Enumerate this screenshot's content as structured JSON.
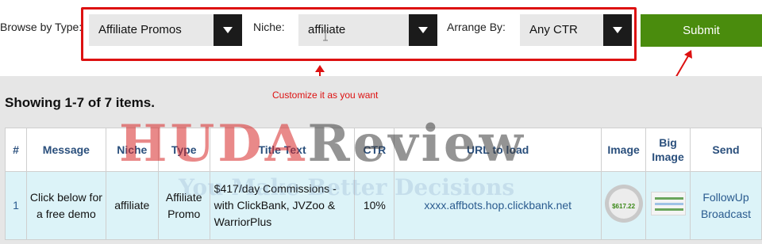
{
  "filters": {
    "browse_label": "Browse by Type:",
    "type_value": "Affiliate Promos",
    "niche_label": "Niche:",
    "niche_value": "affiliate",
    "arrange_label": "Arrange By:",
    "arrange_value": "Any CTR",
    "submit_label": "Submit"
  },
  "annotation": "Customize it as you want",
  "results": {
    "showing": "Showing 1-7 of 7 items.",
    "columns": [
      "#",
      "Message",
      "Niche",
      "Type",
      "Title Text",
      "CTR",
      "URL to load",
      "Image",
      "Big Image",
      "Send"
    ],
    "rows": [
      {
        "num": "1",
        "message": "Click below for a free demo",
        "niche": "affiliate",
        "type": "Affiliate Promo",
        "title_text": "$417/day Commissions - with ClickBank, JVZoo & WarriorPlus",
        "ctr": "10%",
        "url": "xxxx.affbots.hop.clickbank.net",
        "image_amount": "$617.22",
        "send": [
          "FollowUp",
          "Broadcast"
        ]
      }
    ]
  },
  "watermark": {
    "main_a": "HUDA",
    "main_b": "Review",
    "sub": "You Make Better Decisions"
  },
  "colors": {
    "accent_red": "#dd1111",
    "submit_green": "#4a8c0d",
    "header_blue": "#2a4f7c",
    "row_bg": "#dcf3f8"
  }
}
